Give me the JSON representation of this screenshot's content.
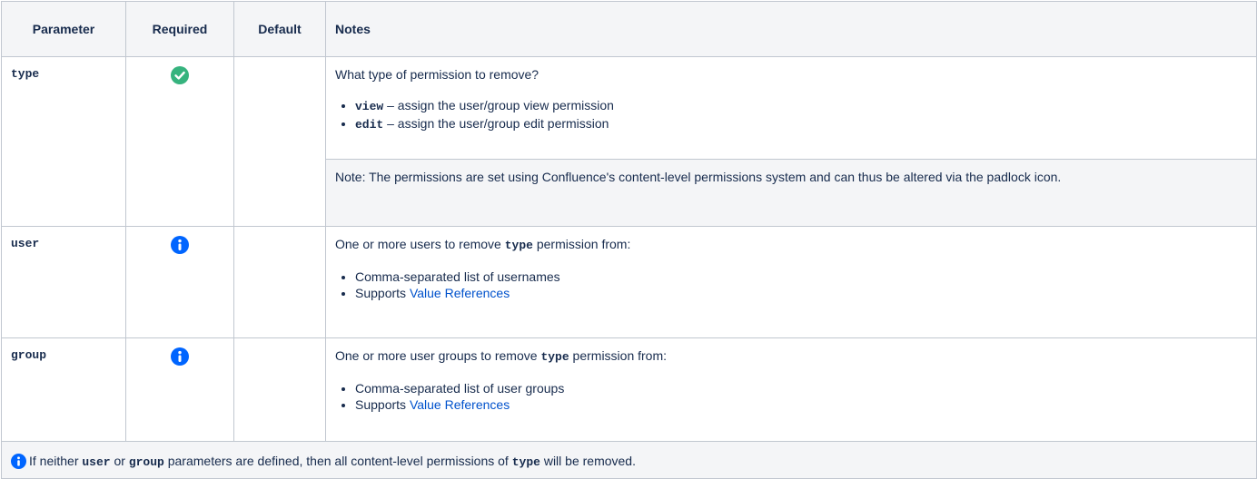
{
  "headers": {
    "parameter": "Parameter",
    "required": "Required",
    "default": "Default",
    "notes": "Notes"
  },
  "rows": {
    "type": {
      "name": "type",
      "required_icon": "check-icon",
      "default": "",
      "intro": "What type of permission to remove?",
      "items": [
        {
          "code": "view",
          "text": " – assign the user/group view permission"
        },
        {
          "code": "edit",
          "text": " – assign the user/group edit permission"
        }
      ],
      "note": "Note: The permissions are set using Confluence's content-level permissions system and can thus be altered via the padlock icon."
    },
    "user": {
      "name": "user",
      "required_icon": "info-icon",
      "default": "",
      "intro_before": "One or more users to remove ",
      "intro_code": "type",
      "intro_after": " permission from:",
      "item1": "Comma-separated list of usernames",
      "item2_before": "Supports ",
      "item2_link": "Value References"
    },
    "group": {
      "name": "group",
      "required_icon": "info-icon",
      "default": "",
      "intro_before": "One or more user groups to remove ",
      "intro_code": "type",
      "intro_after": " permission from:",
      "item1": "Comma-separated list of user groups",
      "item2_before": "Supports ",
      "item2_link": "Value References"
    }
  },
  "footer": {
    "icon": "info-icon",
    "t1": "If neither ",
    "c1": "user",
    "t2": " or ",
    "c2": "group",
    "t3": " parameters are defined, then all content-level permissions of ",
    "c3": "type",
    "t4": " will be removed."
  },
  "colors": {
    "check": "#36b37e",
    "info": "#0065ff",
    "link": "#0052cc",
    "header_bg": "#f4f5f7",
    "border": "#c1c7d0"
  }
}
